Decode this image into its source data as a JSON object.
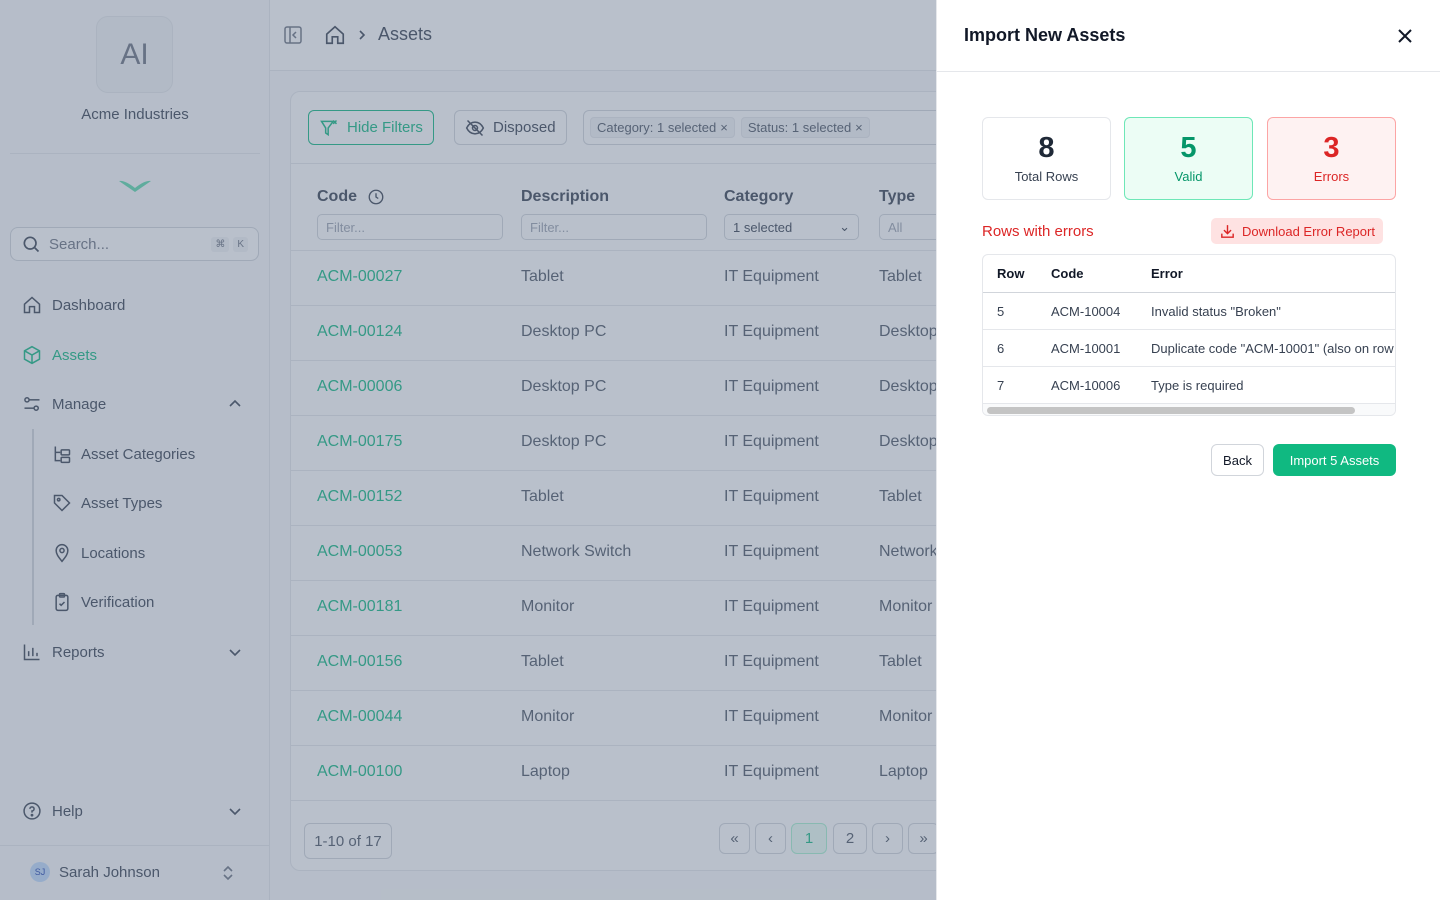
{
  "org": {
    "initials": "AI",
    "name": "Acme Industries"
  },
  "search": {
    "placeholder": "Search...",
    "kbd_cmd": "⌘",
    "kbd_key": "K"
  },
  "nav": {
    "dashboard": "Dashboard",
    "assets": "Assets",
    "manage": "Manage",
    "manage_items": [
      "Asset Categories",
      "Asset Types",
      "Locations",
      "Verification"
    ],
    "reports": "Reports",
    "help": "Help"
  },
  "user": {
    "initials": "SJ",
    "name": "Sarah Johnson"
  },
  "breadcrumb": {
    "current": "Assets"
  },
  "filters": {
    "hide_filters": "Hide Filters",
    "disposed": "Disposed",
    "chips": [
      "Category: 1 selected",
      "Status: 1 selected"
    ]
  },
  "table": {
    "columns": {
      "code": "Code",
      "description": "Description",
      "category": "Category",
      "type": "Type"
    },
    "filter_placeholder": "Filter...",
    "category_filter_value": "1 selected",
    "type_filter_value": "All",
    "rows": [
      {
        "code": "ACM-00027",
        "description": "Tablet",
        "category": "IT Equipment",
        "type": "Tablet"
      },
      {
        "code": "ACM-00124",
        "description": "Desktop PC",
        "category": "IT Equipment",
        "type": "Desktop"
      },
      {
        "code": "ACM-00006",
        "description": "Desktop PC",
        "category": "IT Equipment",
        "type": "Desktop"
      },
      {
        "code": "ACM-00175",
        "description": "Desktop PC",
        "category": "IT Equipment",
        "type": "Desktop"
      },
      {
        "code": "ACM-00152",
        "description": "Tablet",
        "category": "IT Equipment",
        "type": "Tablet"
      },
      {
        "code": "ACM-00053",
        "description": "Network Switch",
        "category": "IT Equipment",
        "type": "Network"
      },
      {
        "code": "ACM-00181",
        "description": "Monitor",
        "category": "IT Equipment",
        "type": "Monitor"
      },
      {
        "code": "ACM-00156",
        "description": "Tablet",
        "category": "IT Equipment",
        "type": "Tablet"
      },
      {
        "code": "ACM-00044",
        "description": "Monitor",
        "category": "IT Equipment",
        "type": "Monitor"
      },
      {
        "code": "ACM-00100",
        "description": "Laptop",
        "category": "IT Equipment",
        "type": "Laptop"
      }
    ]
  },
  "pagination": {
    "info": "1-10 of 17",
    "pages": [
      "1",
      "2"
    ],
    "current_page": 1
  },
  "drawer": {
    "title": "Import New Assets",
    "stats": [
      {
        "value": "8",
        "label": "Total Rows"
      },
      {
        "value": "5",
        "label": "Valid"
      },
      {
        "value": "3",
        "label": "Errors"
      }
    ],
    "errors_title": "Rows with errors",
    "download_label": "Download Error Report",
    "error_columns": {
      "row": "Row",
      "code": "Code",
      "error": "Error"
    },
    "error_rows": [
      {
        "row": "5",
        "code": "ACM-10004",
        "error": "Invalid status \"Broken\""
      },
      {
        "row": "6",
        "code": "ACM-10001",
        "error": "Duplicate code \"ACM-10001\" (also on row"
      },
      {
        "row": "7",
        "code": "ACM-10006",
        "error": "Type is required"
      }
    ],
    "back_label": "Back",
    "import_label": "Import 5 Assets"
  },
  "colors": {
    "accent": "#10b981",
    "error": "#dc2626",
    "overlay": "#64748b"
  },
  "icons": [
    "search-icon",
    "home-icon",
    "cube-icon",
    "sliders-icon",
    "chevron-up-icon",
    "chevron-down-icon",
    "hierarchy-icon",
    "tag-icon",
    "map-pin-icon",
    "clipboard-check-icon",
    "bar-chart-icon",
    "help-circle-icon",
    "filter-x-icon",
    "eye-off-icon",
    "clock-icon",
    "close-icon",
    "download-icon",
    "sidebar-collapse-icon"
  ]
}
